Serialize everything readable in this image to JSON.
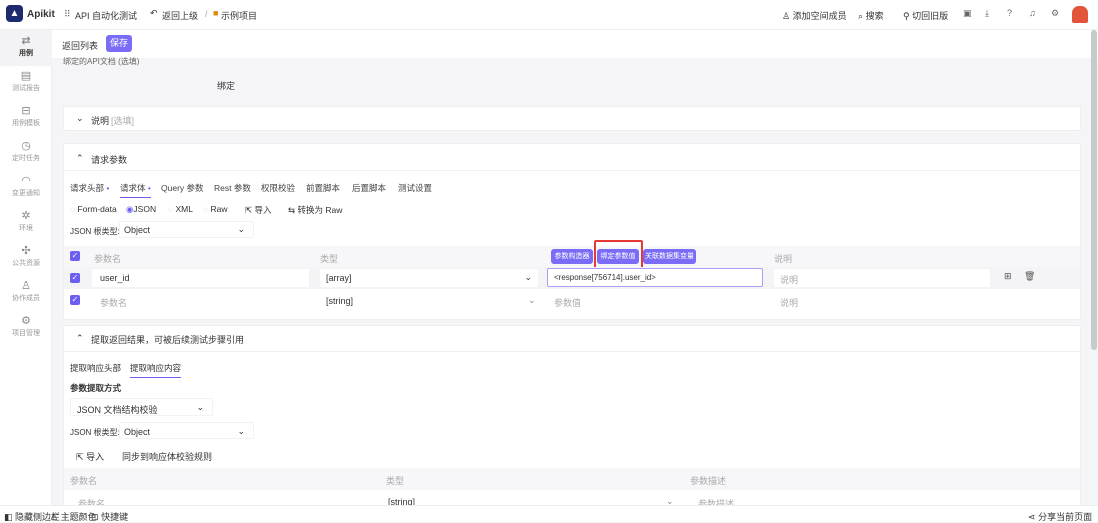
{
  "topbar": {
    "brand": "Apikit",
    "module": "API 自动化测试",
    "back": "返回上级",
    "project": "示例项目",
    "add_member": "添加空间成员",
    "search": "搜索",
    "old_version": "切回旧版"
  },
  "sidebar": {
    "items": [
      {
        "label": "用例"
      },
      {
        "label": "测试报告"
      },
      {
        "label": "用例模板"
      },
      {
        "label": "定时任务"
      },
      {
        "label": "变更通知"
      },
      {
        "label": "环境"
      },
      {
        "label": "公共资源"
      },
      {
        "label": "协作成员"
      },
      {
        "label": "项目管理"
      }
    ]
  },
  "toolbar": {
    "back_list": "返回列表",
    "save": "保存"
  },
  "bind_api": {
    "label": "绑定的API文档 (选填)",
    "bind_button": "绑定"
  },
  "description": {
    "title": "说明",
    "hint": "[选填]"
  },
  "request": {
    "title": "请求参数",
    "tabs": [
      "请求头部",
      "请求体",
      "Query 参数",
      "Rest 参数",
      "权限校验",
      "前置脚本",
      "后置脚本",
      "测试设置"
    ],
    "body_types": [
      "Form-data",
      "JSON",
      "XML",
      "Raw"
    ],
    "import": "导入",
    "convert_raw": "转换为 Raw",
    "root_label": "JSON 根类型:",
    "root_value": "Object",
    "columns": {
      "name": "参数名",
      "type": "类型",
      "desc": "说明"
    },
    "value_buttons": [
      "参数构造器",
      "绑定参数值",
      "关联数据集变量"
    ],
    "rows": [
      {
        "name": "user_id",
        "type": "[array]",
        "value": "<response[756714].user_id>",
        "desc_placeholder": "说明"
      },
      {
        "name_placeholder": "参数名",
        "type": "[string]",
        "value_placeholder": "参数值",
        "desc_placeholder": "说明"
      }
    ]
  },
  "extract": {
    "title": "提取返回结果，可被后续测试步骤引用",
    "tabs": [
      "提取响应头部",
      "提取响应内容"
    ],
    "method_label": "参数提取方式",
    "method_value": "JSON 文档结构校验",
    "root_label": "JSON 根类型:",
    "root_value": "Object",
    "import": "导入",
    "sync": "同步到响应体校验规则",
    "columns": {
      "name": "参数名",
      "type": "类型",
      "desc": "参数描述"
    },
    "row": {
      "name_placeholder": "参数名",
      "type": "[string]",
      "desc_placeholder": "参数描述"
    }
  },
  "footer": {
    "hide_sidebar": "隐藏侧边栏",
    "theme": "主题颜色",
    "shortcuts": "快捷键",
    "share": "分享当前页面"
  },
  "colors": {
    "accent": "#7b6cf6",
    "highlight": "#e53935"
  }
}
